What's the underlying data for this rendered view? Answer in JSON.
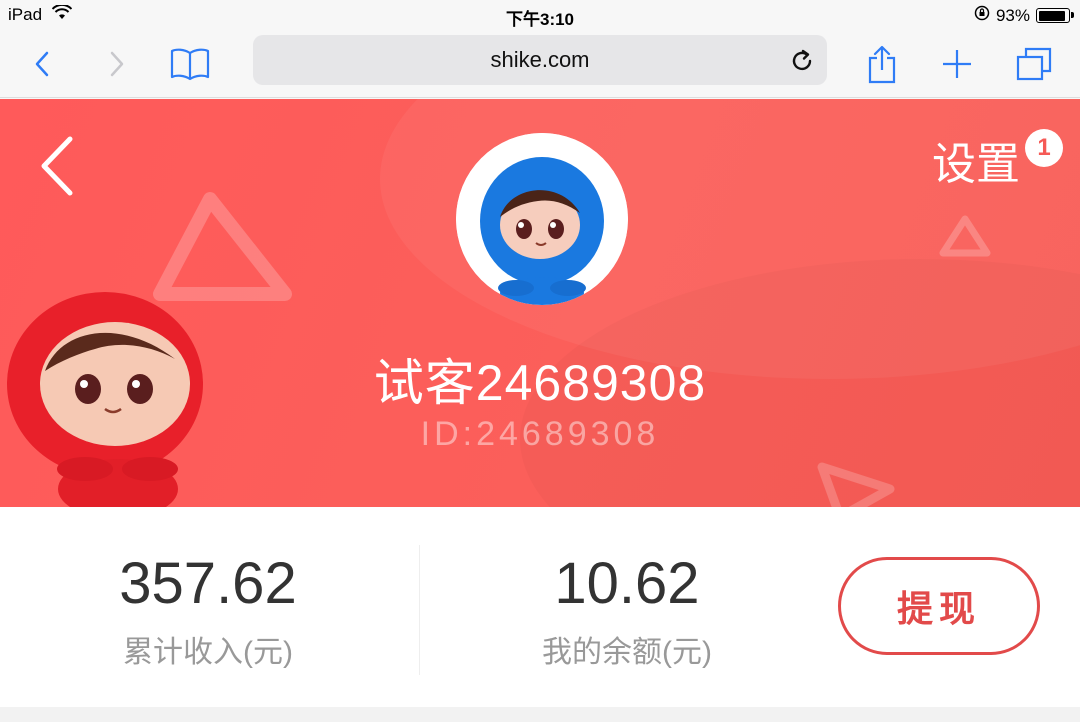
{
  "status_bar": {
    "device": "iPad",
    "time": "下午3:10",
    "battery_percent": "93%",
    "battery_level": 0.93
  },
  "browser": {
    "url": "shike.com",
    "icons": [
      "back-icon",
      "forward-icon",
      "bookmarks-icon",
      "reload-icon",
      "share-icon",
      "new-tab-icon",
      "tabs-icon"
    ]
  },
  "profile": {
    "settings_label": "设置",
    "settings_badge": "1",
    "username": "试客24689308",
    "user_id": "ID:24689308"
  },
  "stats": {
    "total_income": {
      "value": "357.62",
      "label": "累计收入(元)"
    },
    "balance": {
      "value": "10.62",
      "label": "我的余额(元)"
    },
    "withdraw_label": "提现"
  },
  "colors": {
    "brand_red": "#f95c58",
    "withdraw_red": "#e24a4a",
    "ios_blue": "#2f7cf6"
  }
}
